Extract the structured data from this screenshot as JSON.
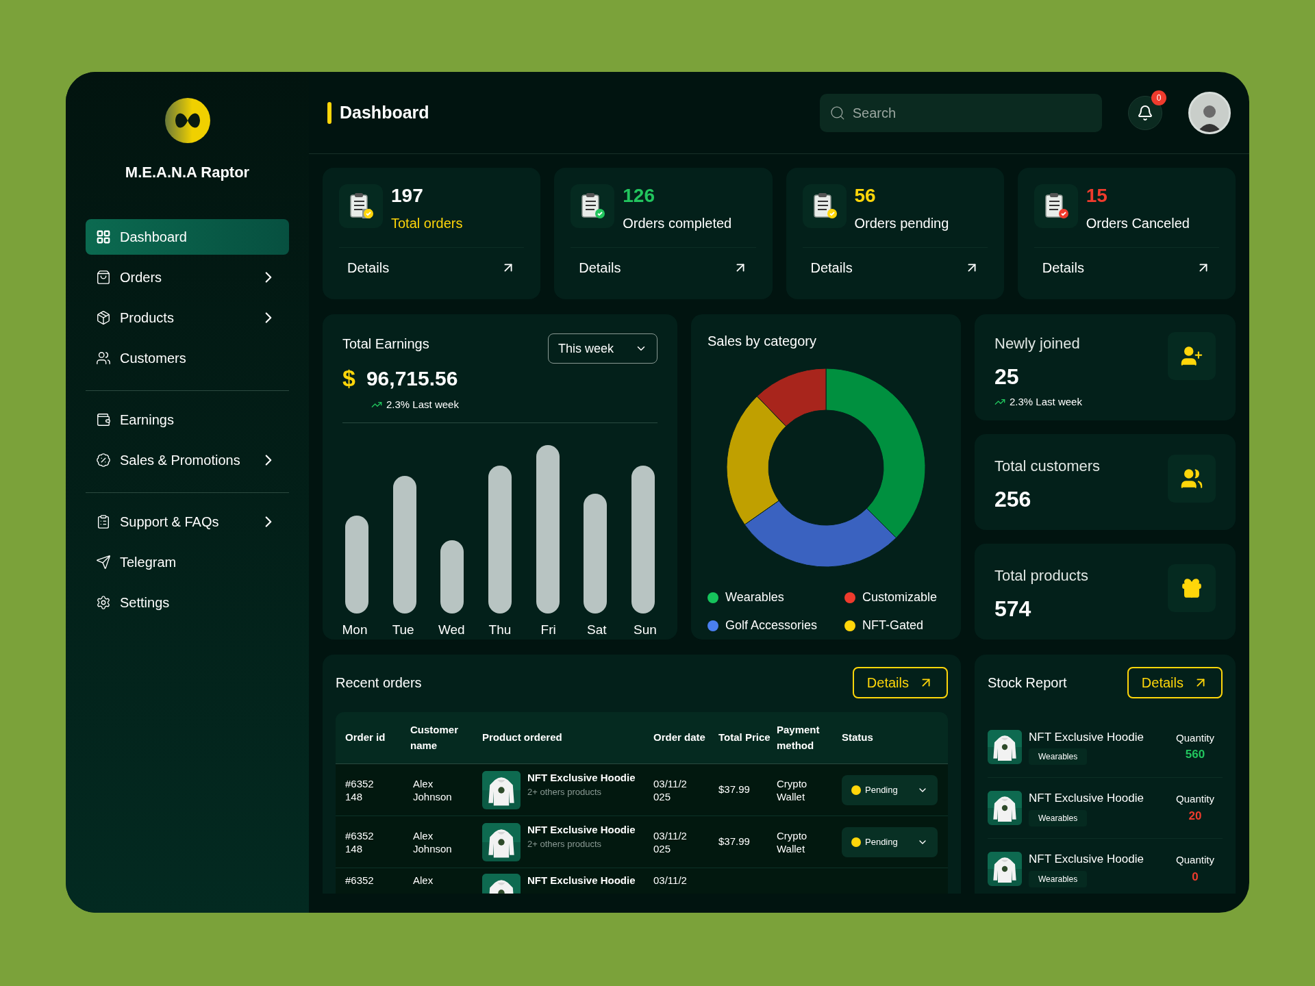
{
  "sidebar": {
    "brand": "M.E.A.N.A Raptor",
    "groups": [
      {
        "items": [
          {
            "label": "Dashboard",
            "selected": true,
            "expandable": false
          },
          {
            "label": "Orders",
            "selected": false,
            "expandable": true
          },
          {
            "label": "Products",
            "selected": false,
            "expandable": true
          },
          {
            "label": "Customers",
            "selected": false,
            "expandable": false
          }
        ]
      },
      {
        "items": [
          {
            "label": "Earnings",
            "selected": false,
            "expandable": false
          },
          {
            "label": "Sales & Promotions",
            "selected": false,
            "expandable": true
          }
        ]
      },
      {
        "items": [
          {
            "label": "Support & FAQs",
            "selected": false,
            "expandable": true
          },
          {
            "label": "Telegram",
            "selected": false,
            "expandable": false
          },
          {
            "label": "Settings",
            "selected": false,
            "expandable": false
          }
        ]
      }
    ]
  },
  "header": {
    "title": "Dashboard",
    "search": {
      "placeholder": "Search"
    },
    "notifications": "0"
  },
  "stats": [
    {
      "value": "197",
      "label": "Total orders",
      "kind": "label",
      "color": "#ffd60a",
      "link": "Details"
    },
    {
      "value": "126",
      "label": "Orders completed",
      "kind": "value",
      "color": "#22c55e",
      "link": "Details"
    },
    {
      "value": "56",
      "label": "Orders pending",
      "kind": "value",
      "color": "#ffd60a",
      "link": "Details"
    },
    {
      "value": "15",
      "label": "Orders Canceled",
      "kind": "value",
      "color": "#ef3b2d",
      "link": "Details"
    }
  ],
  "earnings": {
    "title": "Total Earnings",
    "currency": "$",
    "amount": "96,715.56",
    "change": "2.3% Last week",
    "period": "This week",
    "days": [
      "Mon",
      "Tue",
      "Wed",
      "Thu",
      "Fri",
      "Sat",
      "Sun"
    ]
  },
  "sales": {
    "title": "Sales by category",
    "legend": [
      {
        "label": "Wearables",
        "color": "#16c35c"
      },
      {
        "label": "Customizable",
        "color": "#ef3b2d"
      },
      {
        "label": "Golf Accessories",
        "color": "#4a7ff0"
      },
      {
        "label": "NFT-Gated",
        "color": "#ffd60a"
      }
    ]
  },
  "summary": [
    {
      "title": "Newly joined",
      "value": "25",
      "change": "2.3% Last week"
    },
    {
      "title": "Total customers",
      "value": "256"
    },
    {
      "title": "Total products",
      "value": "574"
    }
  ],
  "recent_orders": {
    "title": "Recent orders",
    "button": "Details",
    "columns": [
      "Order id",
      "Customer name",
      "Product ordered",
      "Order date",
      "Total Price",
      "Payment method",
      "Status"
    ],
    "rows": [
      {
        "order_id": "#6352148",
        "customer": "Alex Johnson",
        "product": "NFT Exclusive Hoodie",
        "others": "2+ others products",
        "date": "03/11/2025",
        "price": "$37.99",
        "payment": "Crypto Wallet",
        "status": {
          "label": "Pending",
          "color": "#ffd60a"
        }
      },
      {
        "order_id": "#6352148",
        "customer": "Alex Johnson",
        "product": "NFT Exclusive Hoodie",
        "others": "2+ others products",
        "date": "03/11/2025",
        "price": "$37.99",
        "payment": "Crypto Wallet",
        "status": {
          "label": "Pending",
          "color": "#ffd60a"
        }
      },
      {
        "order_id": "#6352",
        "customer": "Alex",
        "product": "NFT Exclusive Hoodie",
        "date": "03/11/2"
      }
    ]
  },
  "stock": {
    "title": "Stock Report",
    "button": "Details",
    "items": [
      {
        "name": "NFT Exclusive Hoodie",
        "category": "Wearables",
        "quantity_label": "Quantity",
        "quantity": "560",
        "color": "#22c55e"
      },
      {
        "name": "NFT Exclusive Hoodie",
        "category": "Wearables",
        "quantity_label": "Quantity",
        "quantity": "20",
        "color": "#ef3b2d"
      },
      {
        "name": "NFT Exclusive Hoodie",
        "category": "Wearables",
        "quantity_label": "Quantity",
        "quantity": "0",
        "color": "#ef3b2d"
      }
    ]
  }
}
